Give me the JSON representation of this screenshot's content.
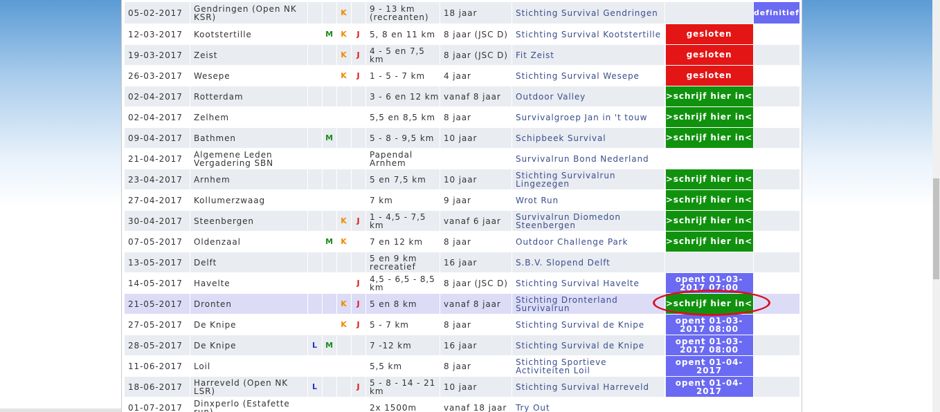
{
  "rows": [
    {
      "date": "05-02-2017",
      "place": "Gendringen (Open NK KSR)",
      "L": "",
      "M": "",
      "K": "K",
      "J": "",
      "distance": "9 - 13 km (recreanten)",
      "age": "18 jaar",
      "org": "Stichting Survival Gendringen",
      "action": {
        "type": "none",
        "label": ""
      },
      "extra": "definitief"
    },
    {
      "date": "12-03-2017",
      "place": "Kootstertille",
      "L": "",
      "M": "M",
      "K": "K",
      "J": "J",
      "distance": "5, 8 en 11 km",
      "age": "8 jaar (JSC D)",
      "org": "Stichting Survival Kootstertille",
      "action": {
        "type": "closed",
        "label": "gesloten"
      },
      "extra": ""
    },
    {
      "date": "19-03-2017",
      "place": "Zeist",
      "L": "",
      "M": "",
      "K": "K",
      "J": "J",
      "distance": "4 - 5 en 7,5 km",
      "age": "8 jaar (JSC D)",
      "org": "Fit Zeist",
      "action": {
        "type": "closed",
        "label": "gesloten"
      },
      "extra": ""
    },
    {
      "date": "26-03-2017",
      "place": "Wesepe",
      "L": "",
      "M": "",
      "K": "K",
      "J": "J",
      "distance": "1 - 5 - 7 km",
      "age": "4 jaar",
      "org": "Stichting Survival Wesepe",
      "action": {
        "type": "closed",
        "label": "gesloten"
      },
      "extra": ""
    },
    {
      "date": "02-04-2017",
      "place": "Rotterdam",
      "L": "",
      "M": "",
      "K": "",
      "J": "",
      "distance": "3 - 6 en 12 km",
      "age": "vanaf 8 jaar",
      "org": "Outdoor Valley",
      "action": {
        "type": "open",
        "label": ">schrijf hier in<"
      },
      "extra": ""
    },
    {
      "date": "02-04-2017",
      "place": "Zelhem",
      "L": "",
      "M": "",
      "K": "",
      "J": "",
      "distance": "5,5 en 8,5 km",
      "age": "8 jaar",
      "org": "Survivalgroep Jan in 't touw",
      "action": {
        "type": "open",
        "label": ">schrijf hier in<"
      },
      "extra": ""
    },
    {
      "date": "09-04-2017",
      "place": "Bathmen",
      "L": "",
      "M": "M",
      "K": "",
      "J": "",
      "distance": "5 - 8 - 9,5 km",
      "age": "10 jaar",
      "org": "Schipbeek Survival",
      "action": {
        "type": "open",
        "label": ">schrijf hier in<"
      },
      "extra": ""
    },
    {
      "date": "21-04-2017",
      "place": "Algemene Leden Vergadering SBN",
      "L": "",
      "M": "",
      "K": "",
      "J": "",
      "distance": "Papendal Arnhem",
      "age": "",
      "org": "Survivalrun Bond Nederland",
      "action": {
        "type": "none",
        "label": ""
      },
      "extra": ""
    },
    {
      "date": "23-04-2017",
      "place": "Arnhem",
      "L": "",
      "M": "",
      "K": "",
      "J": "",
      "distance": "5 en 7,5 km",
      "age": "10 jaar",
      "org": "Stichting Survivalrun Lingezegen",
      "action": {
        "type": "open",
        "label": ">schrijf hier in<"
      },
      "extra": ""
    },
    {
      "date": "27-04-2017",
      "place": "Kollumerzwaag",
      "L": "",
      "M": "",
      "K": "",
      "J": "",
      "distance": "7 km",
      "age": "9 jaar",
      "org": "Wrot Run",
      "action": {
        "type": "open",
        "label": ">schrijf hier in<"
      },
      "extra": ""
    },
    {
      "date": "30-04-2017",
      "place": "Steenbergen",
      "L": "",
      "M": "",
      "K": "K",
      "J": "J",
      "distance": "1 - 4,5 - 7,5 km",
      "age": "vanaf 6 jaar",
      "org": "Survivalrun Diomedon Steenbergen",
      "action": {
        "type": "open",
        "label": ">schrijf hier in<"
      },
      "extra": ""
    },
    {
      "date": "07-05-2017",
      "place": "Oldenzaal",
      "L": "",
      "M": "M",
      "K": "K",
      "J": "",
      "distance": "7 en 12 km",
      "age": "8 jaar",
      "org": "Outdoor Challenge Park",
      "action": {
        "type": "open",
        "label": ">schrijf hier in<"
      },
      "extra": ""
    },
    {
      "date": "13-05-2017",
      "place": "Delft",
      "L": "",
      "M": "",
      "K": "",
      "J": "",
      "distance": "5 en 9 km recreatief",
      "age": "16 jaar",
      "org": "S.B.V. Slopend Delft",
      "action": {
        "type": "none",
        "label": ""
      },
      "extra": ""
    },
    {
      "date": "14-05-2017",
      "place": "Havelte",
      "L": "",
      "M": "",
      "K": "",
      "J": "J",
      "distance": "4,5 - 6,5 - 8,5 km",
      "age": "8 jaar (JSC D)",
      "org": "Stichting Survival Havelte",
      "action": {
        "type": "soon",
        "label": "opent 01-03-2017 07:00"
      },
      "extra": ""
    },
    {
      "date": "21-05-2017",
      "place": "Dronten",
      "L": "",
      "M": "",
      "K": "K",
      "J": "J",
      "distance": "5 en 8 km",
      "age": "vanaf 8 jaar",
      "org": "Stichting Dronterland Survivalrun",
      "action": {
        "type": "open",
        "label": ">schrijf hier in<"
      },
      "extra": ""
    },
    {
      "date": "27-05-2017",
      "place": "De Knipe",
      "L": "",
      "M": "",
      "K": "K",
      "J": "J",
      "distance": "5 - 7 km",
      "age": "8 jaar",
      "org": "Stichting Survival de Knipe",
      "action": {
        "type": "soon",
        "label": "opent 01-03-2017 08:00"
      },
      "extra": ""
    },
    {
      "date": "28-05-2017",
      "place": "De Knipe",
      "L": "L",
      "M": "M",
      "K": "",
      "J": "",
      "distance": "7 -12 km",
      "age": "16 jaar",
      "org": "Stichting Survival de Knipe",
      "action": {
        "type": "soon",
        "label": "opent 01-03-2017 08:00"
      },
      "extra": ""
    },
    {
      "date": "11-06-2017",
      "place": "Loil",
      "L": "",
      "M": "",
      "K": "",
      "J": "",
      "distance": "5,5 km",
      "age": "8 jaar",
      "org": "Stichting Sportieve Activiteiten Loil",
      "action": {
        "type": "soon",
        "label": "opent 01-04-2017"
      },
      "extra": ""
    },
    {
      "date": "18-06-2017",
      "place": "Harreveld (Open NK LSR)",
      "L": "L",
      "M": "",
      "K": "",
      "J": "J",
      "distance": "5 - 8 - 14 - 21 km",
      "age": "10 jaar",
      "org": "Stichting Survival Harreveld",
      "action": {
        "type": "soon",
        "label": "opent 01-04-2017"
      },
      "extra": ""
    },
    {
      "date": "01-07-2017",
      "place": "Dinxperlo (Estafette run)",
      "L": "",
      "M": "",
      "K": "",
      "J": "",
      "distance": "2x 1500m",
      "age": "vanaf 18 jaar",
      "org": "Try Out",
      "action": {
        "type": "none",
        "label": ""
      },
      "extra": ""
    }
  ]
}
